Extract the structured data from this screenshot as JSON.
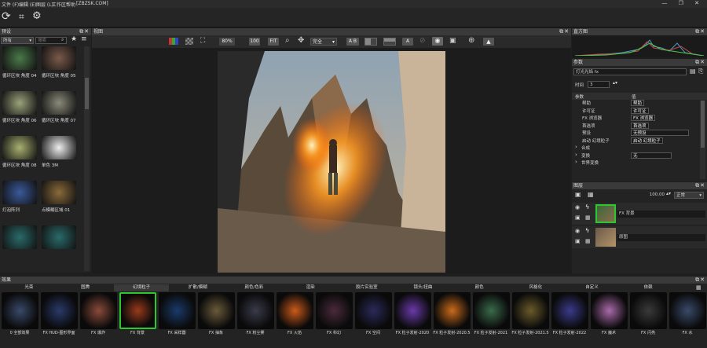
{
  "menu": [
    "文件 (F)",
    "编辑 (E)",
    "图层 (L)",
    "工作区",
    "帮助"
  ],
  "window_title": "[ZBZSK.COM]",
  "panels": {
    "presets": "预设",
    "view": "视图",
    "histogram": "直方图",
    "params": "参数",
    "layers": "图层",
    "effects": "效果"
  },
  "presets": {
    "category": "所有",
    "search_placeholder": "搜索",
    "items": [
      {
        "label": "循环区块 角度 04",
        "color": "#4a7a4a"
      },
      {
        "label": "循环区块 角度 05",
        "color": "#7a5a4a"
      },
      {
        "label": "循环区块 角度 06",
        "color": "#9aa27a"
      },
      {
        "label": "循环区块 角度 07",
        "color": "#8a8a7a"
      },
      {
        "label": "循环区块 角度 08",
        "color": "#a8b070"
      },
      {
        "label": "单色 3M",
        "color": "#eeeeee"
      },
      {
        "label": "灯泡阵列",
        "color": "#3a5a9a"
      },
      {
        "label": "点模糊区域 01",
        "color": "#8a6a3a"
      },
      {
        "label": "",
        "color": "#2a6a6a"
      },
      {
        "label": "",
        "color": "#2a6a6a"
      }
    ]
  },
  "view_toolbar": {
    "zoom": "80%",
    "btn100": "100",
    "fit": "FIT",
    "mode": "完全",
    "ab": "A B"
  },
  "params": {
    "preset_field": "灯光光焰",
    "time_label": "时间",
    "time_value": "3",
    "col_param": "参数",
    "col_value": "值",
    "rows": [
      {
        "name": "帮助",
        "value": "帮助"
      },
      {
        "name": "许可证",
        "value": "许可证"
      },
      {
        "name": "FX 浏览器",
        "value": "FX 浏览器"
      },
      {
        "name": "首选项",
        "value": "首选项"
      },
      {
        "name": "预设",
        "value": "无预设"
      },
      {
        "name": "启动 幻境粒子",
        "value": "启动 幻境粒子"
      },
      {
        "name": "合成",
        "value": ""
      },
      {
        "name": "变换",
        "value": "无"
      },
      {
        "name": "世界变换",
        "value": ""
      }
    ]
  },
  "layers": {
    "opacity": "100.00",
    "blend": "正常",
    "items": [
      {
        "label": "FX 背景"
      },
      {
        "label": "原图"
      }
    ]
  },
  "effects": {
    "categories": [
      "光束",
      "图腾",
      "幻境粒子",
      "扩散/模糊",
      "颜色/色彩",
      "渲染",
      "胶片实验室",
      "镜头/扭曲",
      "颜色",
      "风格化",
      "自定义",
      "依赖"
    ],
    "items": [
      {
        "label": "0 全部效果",
        "color": "#3a4a6a"
      },
      {
        "label": "FX HUD-图形界面",
        "color": "#2a3a6a"
      },
      {
        "label": "FX 爆炸",
        "color": "#8a4a3a"
      },
      {
        "label": "FX 背景",
        "color": "#9a3a1a"
      },
      {
        "label": "FX 采样器",
        "color": "#1a3a6a"
      },
      {
        "label": "FX 抽象",
        "color": "#6a5a3a"
      },
      {
        "label": "FX 粉尘雾",
        "color": "#3a3a4a"
      },
      {
        "label": "FX 火焰",
        "color": "#ca5a1a"
      },
      {
        "label": "FX 科幻",
        "color": "#4a2a3a"
      },
      {
        "label": "FX 空间",
        "color": "#2a2a5a"
      },
      {
        "label": "FX 粒子发射-2020",
        "color": "#6a3aaa"
      },
      {
        "label": "FX 粒子发射-2020.5",
        "color": "#ca6a1a"
      },
      {
        "label": "FX 粒子发射-2021",
        "color": "#3a6a4a"
      },
      {
        "label": "FX 粒子发射-2021.5",
        "color": "#6a5a2a"
      },
      {
        "label": "FX 粒子发射-2022",
        "color": "#3a3a8a"
      },
      {
        "label": "FX 魔术",
        "color": "#aa6aaa"
      },
      {
        "label": "FX 闪亮",
        "color": "#3a3a3a"
      },
      {
        "label": "FX 水",
        "color": "#3a4a6a"
      }
    ]
  }
}
